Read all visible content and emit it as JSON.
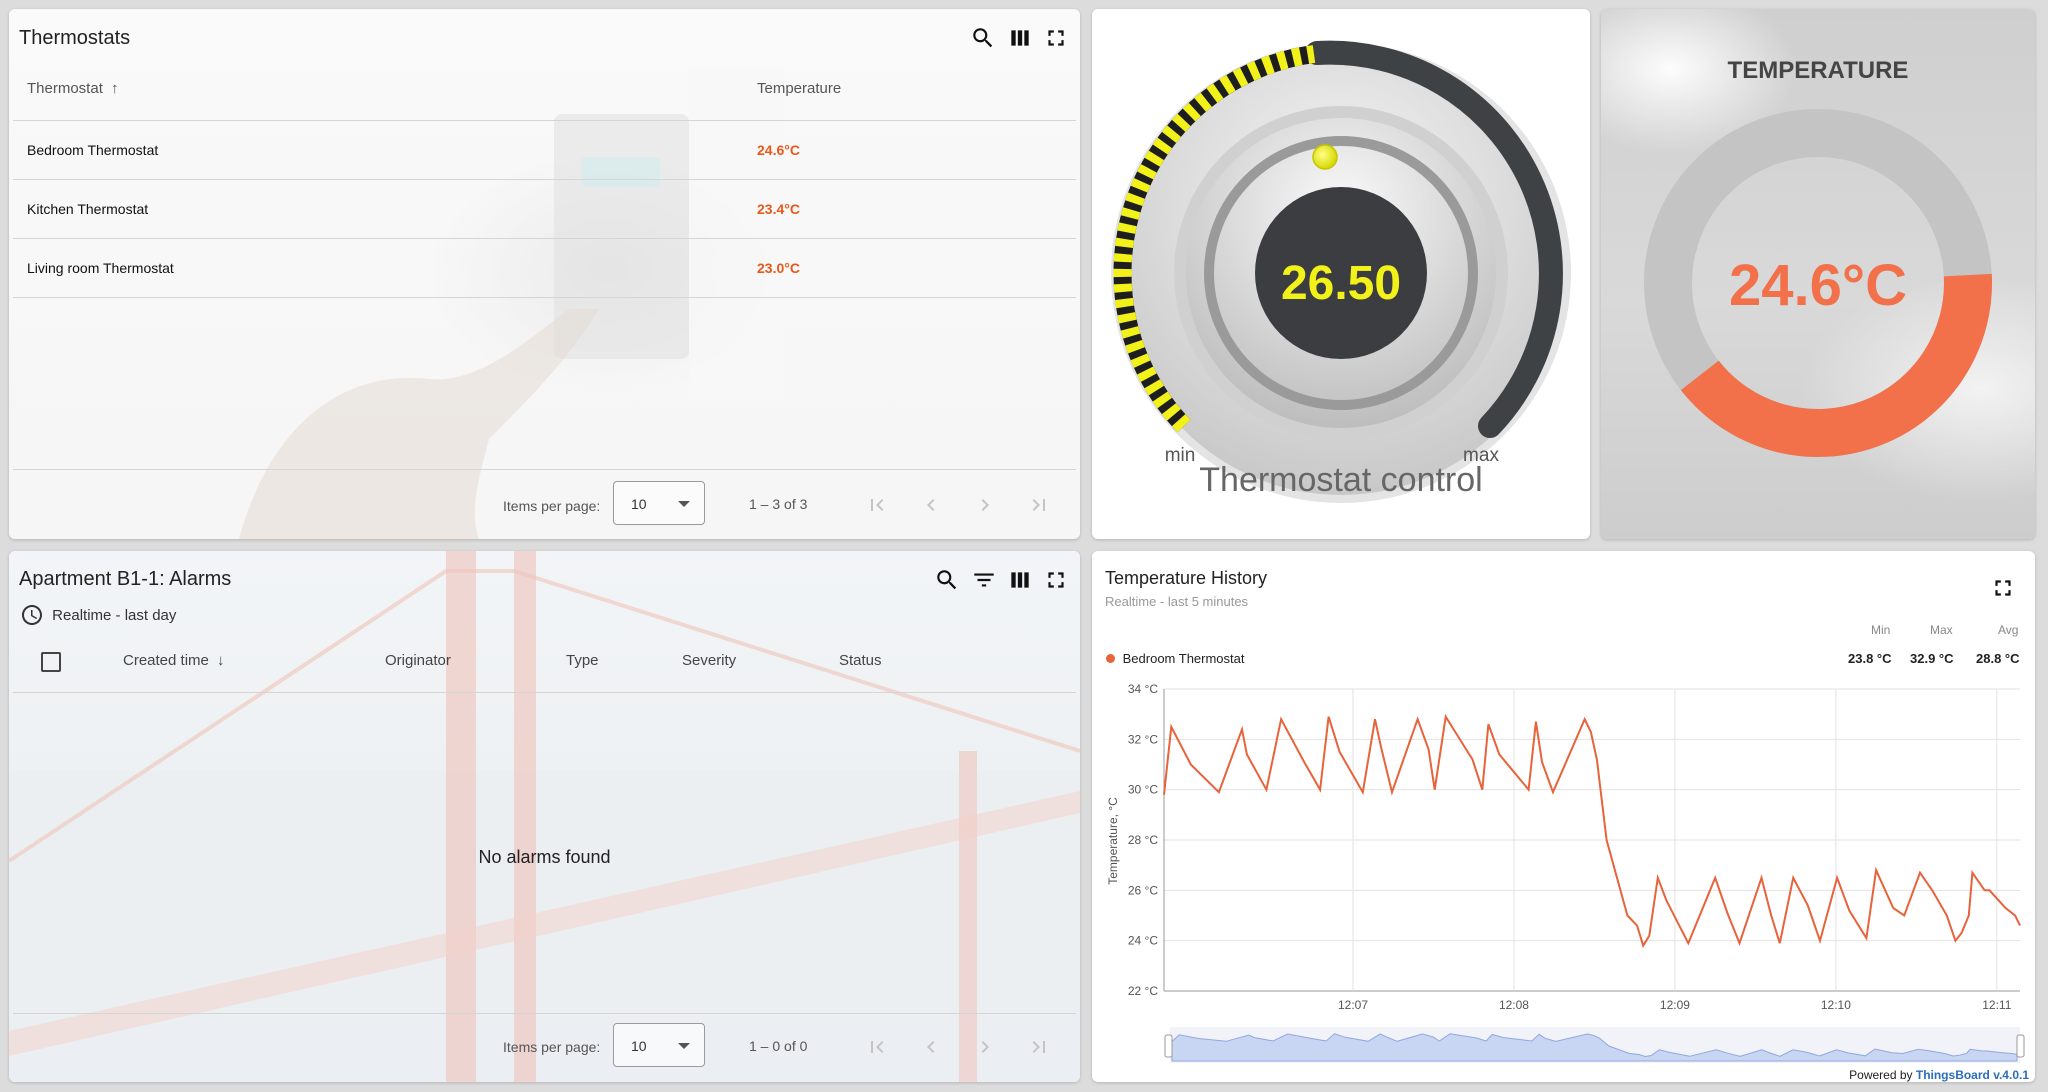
{
  "thermostats": {
    "title": "Thermostats",
    "columns": {
      "name": "Thermostat",
      "temperature": "Temperature"
    },
    "rows": [
      {
        "name": "Bedroom Thermostat",
        "temperature": "24.6°C"
      },
      {
        "name": "Kitchen Thermostat",
        "temperature": "23.4°C"
      },
      {
        "name": "Living room Thermostat",
        "temperature": "23.0°C"
      }
    ],
    "pager": {
      "items_label": "Items per page:",
      "page_size": "10",
      "range": "1 – 3 of 3"
    }
  },
  "control": {
    "value": "26.50",
    "min_label": "min",
    "max_label": "max",
    "title": "Thermostat control",
    "accent": "#f2f21a"
  },
  "gauge": {
    "title": "TEMPERATURE",
    "value_text": "24.6°C",
    "color": "#f2704a"
  },
  "alarms": {
    "title": "Apartment B1-1: Alarms",
    "timewindow": "Realtime - last day",
    "columns": {
      "created": "Created time",
      "originator": "Originator",
      "type": "Type",
      "severity": "Severity",
      "status": "Status"
    },
    "empty_text": "No alarms found",
    "pager": {
      "items_label": "Items per page:",
      "page_size": "10",
      "range": "1 – 0 of 0"
    }
  },
  "history": {
    "title": "Temperature History",
    "subtitle": "Realtime - last 5 minutes",
    "legend_headers": {
      "min": "Min",
      "max": "Max",
      "avg": "Avg"
    },
    "series_name": "Bedroom Thermostat",
    "series_min": "23.8 °C",
    "series_max": "32.9 °C",
    "series_avg": "28.8 °C",
    "footer_prefix": "Powered by ",
    "footer_brand": "ThingsBoard v.4.0.1",
    "series_color": "#e8623a"
  },
  "chart_data": {
    "type": "line",
    "ylabel": "Temperature, °C",
    "ylim": [
      22,
      34
    ],
    "y_ticks": [
      "22 °C",
      "24 °C",
      "26 °C",
      "28 °C",
      "30 °C",
      "32 °C",
      "34 °C"
    ],
    "x_ticks": [
      "12:07",
      "12:08",
      "12:09",
      "12:10",
      "12:11"
    ],
    "series": [
      {
        "name": "Bedroom Thermostat",
        "x": [
          0,
          0.06,
          0.22,
          0.45,
          0.64,
          0.68,
          0.84,
          0.96,
          1.15,
          1.28,
          1.35,
          1.44,
          1.63,
          1.73,
          1.78,
          1.87,
          2.08,
          2.17,
          2.22,
          2.31,
          2.53,
          2.61,
          2.66,
          2.75,
          2.99,
          3.05,
          3.1,
          3.19,
          3.45,
          3.5,
          3.55,
          3.63,
          3.8,
          3.88,
          3.93,
          3.98,
          4.05,
          4.12,
          4.3,
          4.52,
          4.62,
          4.72,
          4.9,
          4.98,
          5.05,
          5.16,
          5.28,
          5.38,
          5.52,
          5.62,
          5.76,
          5.84,
          5.98,
          6.07,
          6.2,
          6.3,
          6.42,
          6.49,
          6.54,
          6.6,
          6.63,
          6.73,
          6.77,
          6.9,
          6.98,
          7.02
        ],
        "values": [
          29.8,
          32.5,
          31.0,
          29.9,
          32.4,
          31.4,
          30.0,
          32.8,
          31.1,
          30.0,
          32.9,
          31.5,
          29.9,
          32.8,
          31.7,
          29.9,
          32.8,
          31.6,
          30.0,
          32.9,
          31.2,
          30.0,
          32.6,
          31.4,
          30.0,
          32.7,
          31.1,
          29.9,
          32.8,
          32.3,
          31.2,
          28.0,
          25.0,
          24.6,
          23.8,
          24.2,
          26.5,
          25.6,
          23.9,
          26.5,
          25.1,
          23.9,
          26.5,
          25.0,
          23.9,
          26.5,
          25.4,
          24.0,
          26.5,
          25.2,
          24.1,
          26.8,
          25.3,
          25.0,
          26.7,
          26.0,
          25.0,
          24.0,
          24.3,
          25.0,
          26.7,
          26.0,
          26.0,
          25.3,
          25.0,
          24.6
        ]
      }
    ],
    "grid": true,
    "legend": "top-left"
  }
}
